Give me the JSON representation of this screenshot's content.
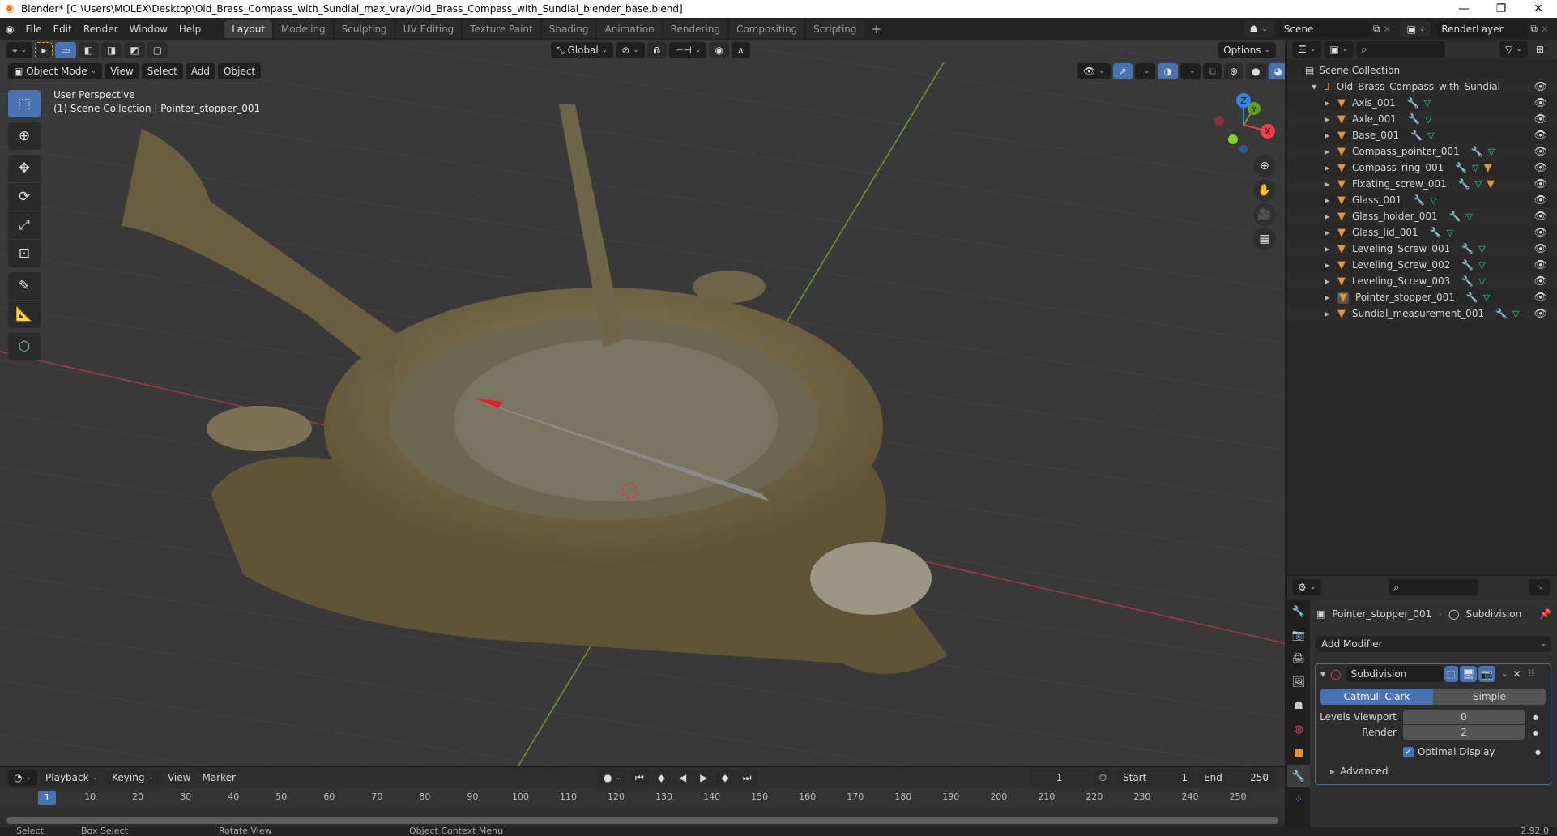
{
  "window": {
    "title": "Blender* [C:\\Users\\MOLEX\\Desktop\\Old_Brass_Compass_with_Sundial_max_vray/Old_Brass_Compass_with_Sundial_blender_base.blend]",
    "controls": [
      "minimize",
      "maximize",
      "close"
    ]
  },
  "menu": [
    "File",
    "Edit",
    "Render",
    "Window",
    "Help"
  ],
  "workspaces": [
    {
      "label": "Layout",
      "active": true
    },
    {
      "label": "Modeling"
    },
    {
      "label": "Sculpting"
    },
    {
      "label": "UV Editing"
    },
    {
      "label": "Texture Paint"
    },
    {
      "label": "Shading"
    },
    {
      "label": "Animation"
    },
    {
      "label": "Rendering"
    },
    {
      "label": "Compositing"
    },
    {
      "label": "Scripting"
    }
  ],
  "add_workspace": "+",
  "scene": {
    "label": "Scene",
    "view_layer": "RenderLayer"
  },
  "viewport": {
    "mode": "Object Mode",
    "menus": [
      "View",
      "Select",
      "Add",
      "Object"
    ],
    "orientation": "Global",
    "options_label": "Options",
    "overlay_title": "User Perspective",
    "overlay_subtitle": "(1) Scene Collection | Pointer_stopper_001",
    "gizmo_axes": {
      "x": "X",
      "y": "Y",
      "z": "Z",
      "x_color": "#f53a4e",
      "y_color": "#6a9a23",
      "z_color": "#2f84e3"
    },
    "tools": [
      "select-box",
      "cursor",
      "move",
      "rotate",
      "scale",
      "transform",
      "annotate",
      "measure",
      "add-cube"
    ],
    "shading_active": "solid-material-preview",
    "accent": "#4772b3"
  },
  "outliner": {
    "root": "Scene Collection",
    "collection": "Old_Brass_Compass_with_Sundial",
    "objects": [
      {
        "name": "Axis_001",
        "extra_mesh": false,
        "selected": false
      },
      {
        "name": "Axle_001",
        "extra_mesh": false,
        "selected": false
      },
      {
        "name": "Base_001",
        "extra_mesh": false,
        "selected": false
      },
      {
        "name": "Compass_pointer_001",
        "extra_mesh": false,
        "selected": false
      },
      {
        "name": "Compass_ring_001",
        "extra_mesh": true,
        "selected": false
      },
      {
        "name": "Fixating_screw_001",
        "extra_mesh": true,
        "selected": false
      },
      {
        "name": "Glass_001",
        "extra_mesh": false,
        "selected": false
      },
      {
        "name": "Glass_holder_001",
        "extra_mesh": false,
        "selected": false
      },
      {
        "name": "Glass_lid_001",
        "extra_mesh": false,
        "selected": false
      },
      {
        "name": "Leveling_Screw_001",
        "extra_mesh": false,
        "selected": false
      },
      {
        "name": "Leveling_Screw_002",
        "extra_mesh": false,
        "selected": false
      },
      {
        "name": "Leveling_Screw_003",
        "extra_mesh": false,
        "selected": false
      },
      {
        "name": "Pointer_stopper_001",
        "extra_mesh": false,
        "selected": true
      },
      {
        "name": "Sundial_measurement_001",
        "extra_mesh": false,
        "selected": false
      }
    ]
  },
  "properties": {
    "breadcrumb_object": "Pointer_stopper_001",
    "breadcrumb_modifier": "Subdivision",
    "add_modifier": "Add Modifier",
    "modifier": {
      "name": "Subdivision",
      "type_options": [
        "Catmull-Clark",
        "Simple"
      ],
      "type_selected": "Catmull-Clark",
      "levels_viewport_label": "Levels Viewport",
      "levels_viewport": "0",
      "render_label": "Render",
      "render": "2",
      "optimal_display_label": "Optimal Display",
      "optimal_display": true,
      "advanced_label": "Advanced"
    },
    "tabs": [
      "tool",
      "render",
      "output",
      "view-layer",
      "scene",
      "world",
      "object",
      "modifiers",
      "particles"
    ],
    "active_tab": "modifiers"
  },
  "timeline": {
    "menus": [
      "Playback",
      "Keying",
      "View",
      "Marker"
    ],
    "current_frame": "1",
    "start_label": "Start",
    "start": "1",
    "end_label": "End",
    "end": "250",
    "ticks": [
      "1",
      "10",
      "20",
      "30",
      "40",
      "50",
      "60",
      "70",
      "80",
      "90",
      "100",
      "110",
      "120",
      "130",
      "140",
      "150",
      "160",
      "170",
      "180",
      "190",
      "200",
      "210",
      "220",
      "230",
      "240",
      "250"
    ]
  },
  "statusbar": {
    "hints": [
      "Select",
      "Box Select",
      "Rotate View",
      "Object Context Menu"
    ],
    "version": "2.92.0"
  }
}
